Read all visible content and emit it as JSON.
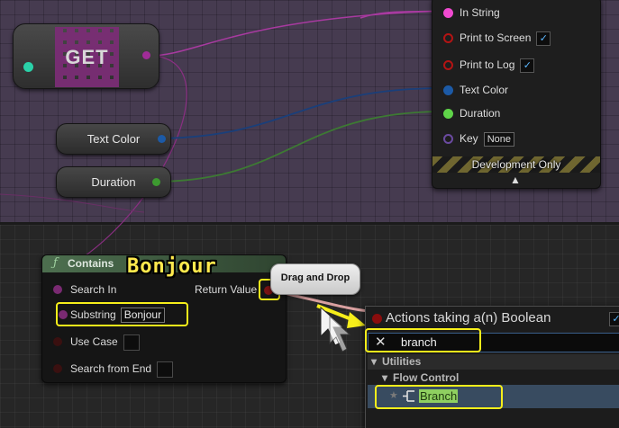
{
  "get_node": {
    "label": "GET"
  },
  "variables": [
    {
      "label": "Text Color"
    },
    {
      "label": "Duration"
    }
  ],
  "print_node": {
    "pins": [
      {
        "label": "In String",
        "color": "#f04ad0"
      },
      {
        "label": "Print to Screen",
        "color": "#b31414",
        "checked": "✓"
      },
      {
        "label": "Print to Log",
        "color": "#b31414",
        "checked": "✓"
      },
      {
        "label": "Text Color",
        "color": "#1c5aa6"
      },
      {
        "label": "Duration",
        "color": "#5fd449"
      },
      {
        "label": "Key",
        "color": "#6a4aa0",
        "value": "None"
      }
    ],
    "footer": "Development Only",
    "chevron": "^"
  },
  "contains_node": {
    "title": "Contains",
    "icon": "ƒ",
    "inputs": {
      "search_in": "Search In",
      "substring": "Substring",
      "substring_value": "Bonjour",
      "use_case": "Use Case",
      "search_from_end": "Search from End"
    },
    "output": "Return Value"
  },
  "annotation": {
    "bonjour": "Bonjour",
    "tooltip": "Drag and Drop"
  },
  "actions_menu": {
    "title": "Actions taking a(n) Boolean",
    "search_value": "branch",
    "checked": "✓",
    "categories": {
      "utilities": "Utilities",
      "flow_control": "Flow Control"
    },
    "result": "Branch"
  },
  "colors": {
    "highlight": "#f6ee1a",
    "string_pin": "#f04ad0",
    "boolean_pin": "#8a0d0d",
    "float_pin": "#5fd449",
    "struct_pin": "#1c5aa6"
  }
}
